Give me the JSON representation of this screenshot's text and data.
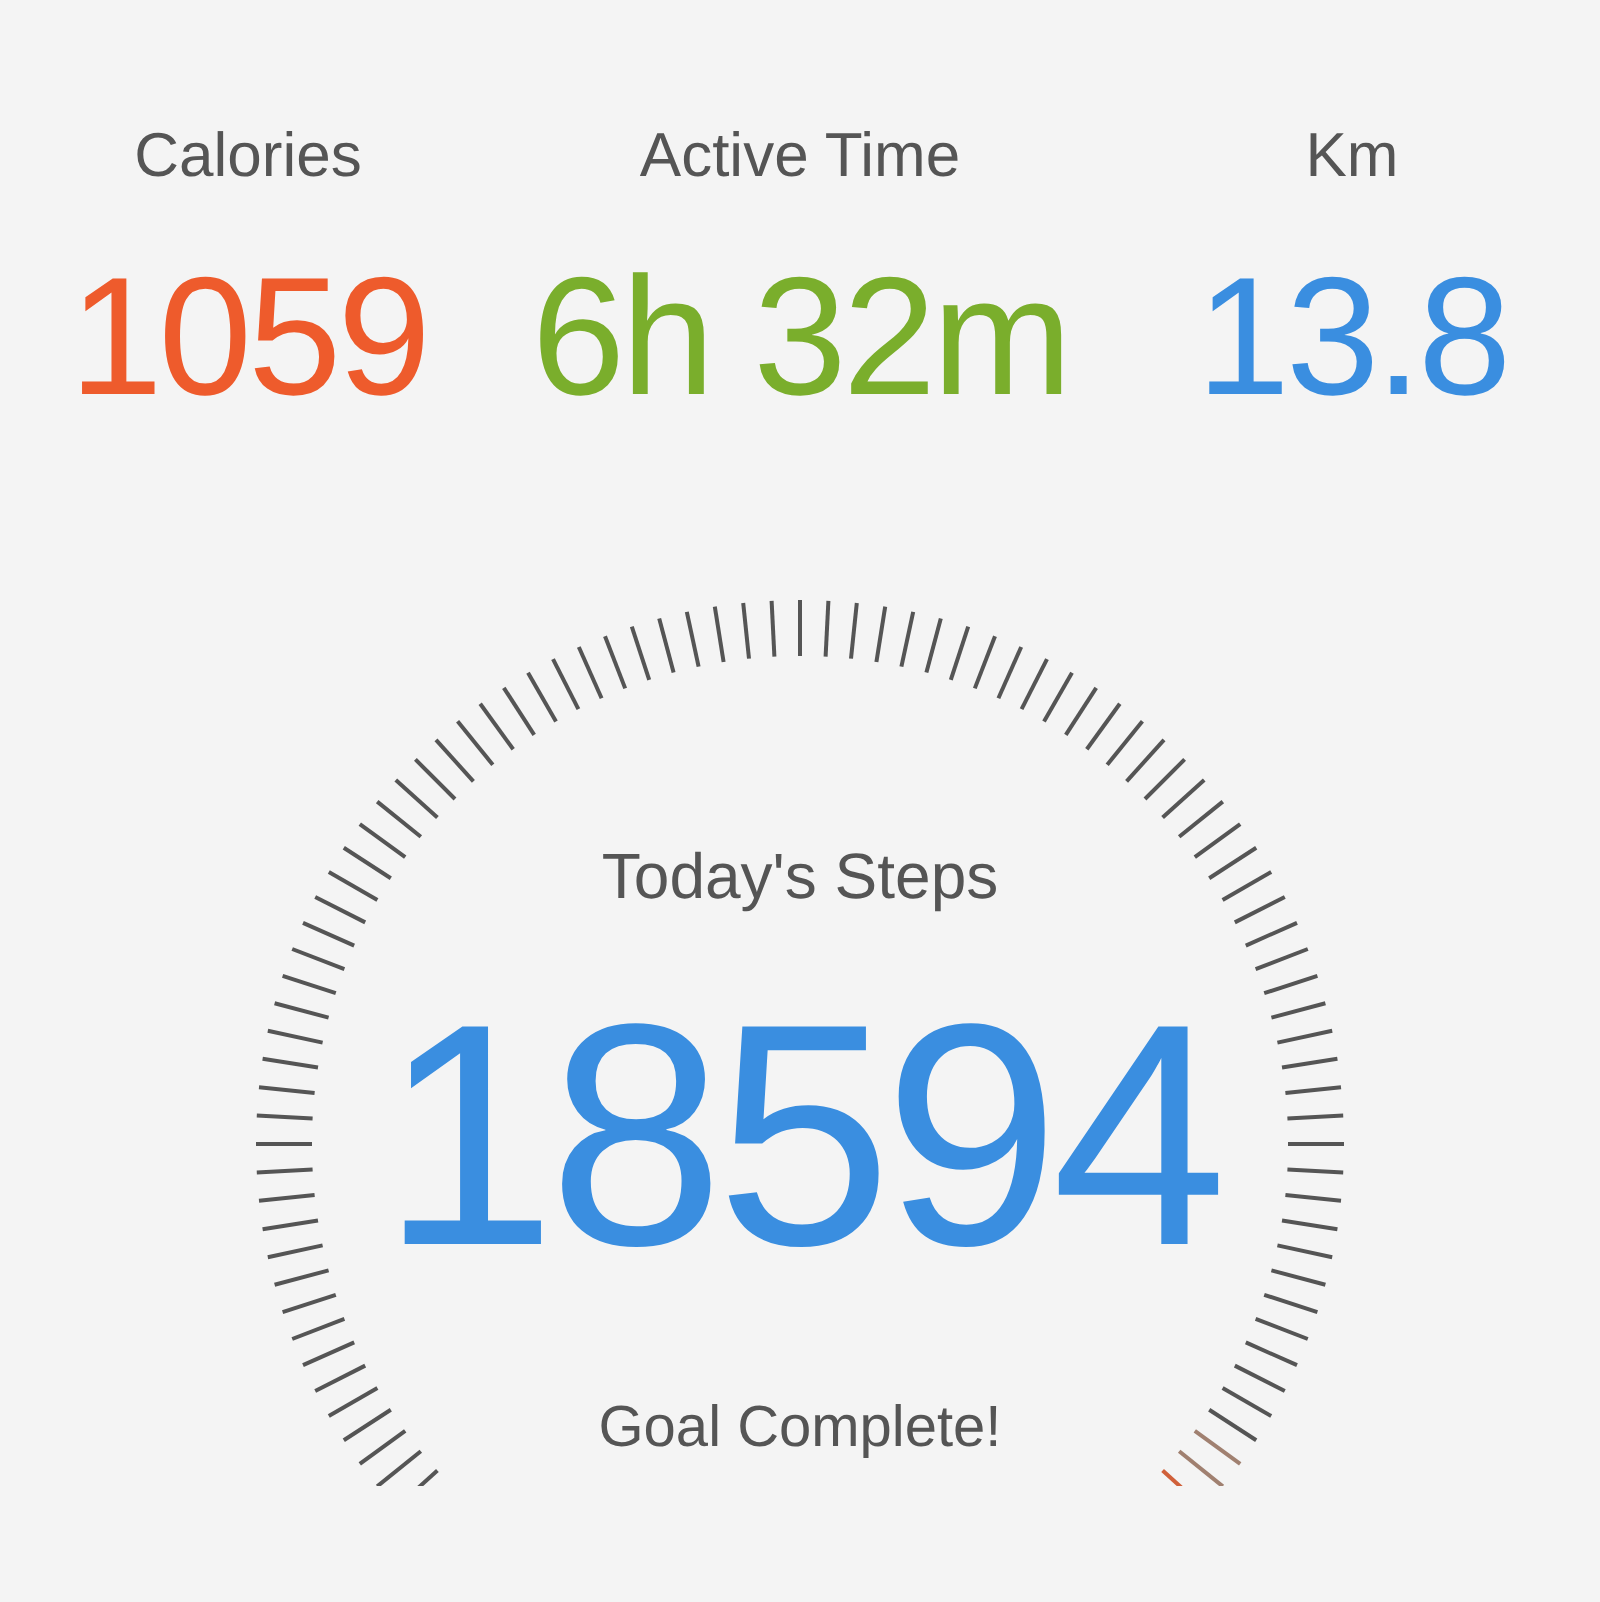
{
  "stats": [
    {
      "label": "Calories",
      "value": "1059",
      "color": "#ee5b2c"
    },
    {
      "label": "Active Time",
      "value": "6h 32m",
      "color": "#7aae2c"
    },
    {
      "label": "Km",
      "value": "13.8",
      "color": "#3a8ee0"
    }
  ],
  "steps": {
    "title": "Today's Steps",
    "value": "18594",
    "status": "Goal Complete!"
  }
}
